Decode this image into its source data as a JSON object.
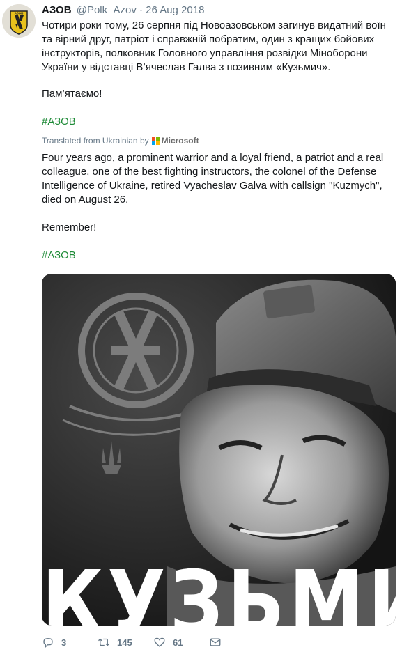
{
  "tweet": {
    "author_name": "АЗОВ",
    "handle": "@Polk_Azov",
    "separator": "·",
    "date": "26 Aug 2018",
    "avatar_label": "АЗОВ",
    "original_text": "Чотири роки тому, 26 серпня під Новоазовськом загинув видатний воїн та вірний друг, патріот і справжній побратим, один з кращих бойових інструкторів, полковник Головного управління розвідки Міноборони України у відставці В’ячеслав Галва з позивним «Кузьмич».",
    "original_remember": "Пам’ятаємо!",
    "original_hashtag": "#АЗОВ",
    "translation_label": "Translated from Ukrainian by",
    "translation_provider": "Microsoft",
    "translated_text": "Four years ago, a prominent warrior and a loyal friend, a patriot and a real colleague, one of the best fighting instructors, the colonel of the Defense Intelligence of Ukraine, retired Vyacheslav Galva with callsign \"Kuzmych\", died on August 26.",
    "translated_remember": "Remember!",
    "translated_hashtag": "#АЗОВ",
    "image_caption": "КУЗЬМИЧ"
  },
  "actions": {
    "replies": "3",
    "retweets": "145",
    "likes": "61"
  },
  "colors": {
    "hashtag": "#1d8a36",
    "secondary_text": "#657786",
    "avatar_yellow": "#e8c11c",
    "microsoft_red": "#f25022",
    "microsoft_green": "#7fba00",
    "microsoft_blue": "#00a4ef",
    "microsoft_yellow": "#ffb900"
  },
  "icons": {
    "reply": "reply-icon",
    "retweet": "retweet-icon",
    "like": "heart-icon",
    "direct_message": "envelope-icon"
  }
}
